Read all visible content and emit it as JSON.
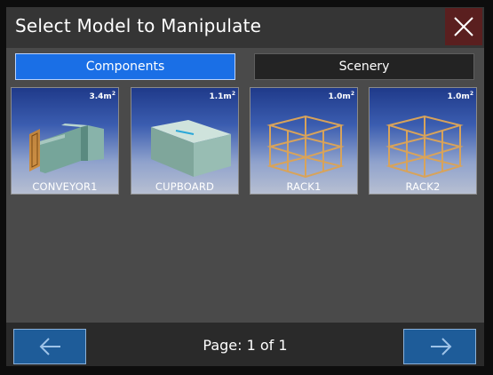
{
  "header": {
    "title": "Select Model to Manipulate",
    "close_icon": "close-icon"
  },
  "tabs": [
    {
      "label": "Components",
      "active": true
    },
    {
      "label": "Scenery",
      "active": false
    }
  ],
  "models": [
    {
      "name": "CONVEYOR1",
      "area": "3.4m",
      "area_unit_sup": "2",
      "thumbnail": "conveyor-model"
    },
    {
      "name": "CUPBOARD",
      "area": "1.1m",
      "area_unit_sup": "2",
      "thumbnail": "cupboard-model"
    },
    {
      "name": "RACK1",
      "area": "1.0m",
      "area_unit_sup": "2",
      "thumbnail": "rack-model"
    },
    {
      "name": "RACK2",
      "area": "1.0m",
      "area_unit_sup": "2",
      "thumbnail": "rack-model"
    }
  ],
  "footer": {
    "page_label": "Page: 1 of 1",
    "prev_icon": "arrow-left-icon",
    "next_icon": "arrow-right-icon"
  },
  "colors": {
    "accent": "#1a6fe6",
    "nav_button": "#1e5c99",
    "close_button": "#5a1f1f"
  }
}
